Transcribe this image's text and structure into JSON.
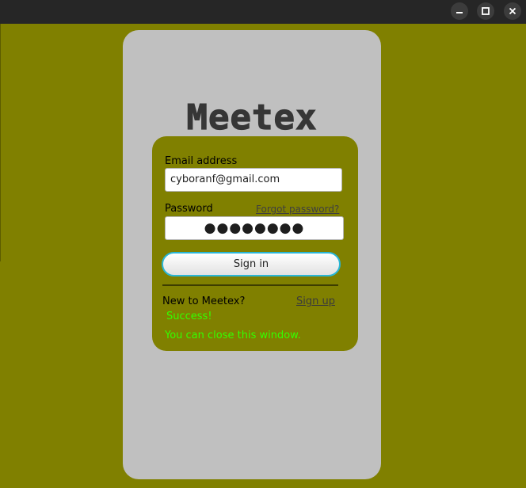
{
  "window": {
    "controls": [
      {
        "name": "minimize",
        "icon": "minimize-icon"
      },
      {
        "name": "maximize",
        "icon": "maximize-icon"
      },
      {
        "name": "close",
        "icon": "close-icon"
      }
    ]
  },
  "app": {
    "logo_text": "Meetex"
  },
  "form": {
    "email_label": "Email address",
    "email_value": "cyboranf@gmail.com",
    "password_label": "Password",
    "forgot_link": "Forgot password?",
    "password_masked": "●●●●●●●●",
    "signin_button": "Sign in",
    "new_user_text": "New to Meetex?",
    "signup_link": "Sign up",
    "status_message": "Success!",
    "status_detail": "You can close this window."
  },
  "colors": {
    "background": "#808000",
    "card": "#c0c0c0",
    "panel": "#808000",
    "success_text": "#33ff00",
    "button_focus_border": "#29b6d6"
  }
}
